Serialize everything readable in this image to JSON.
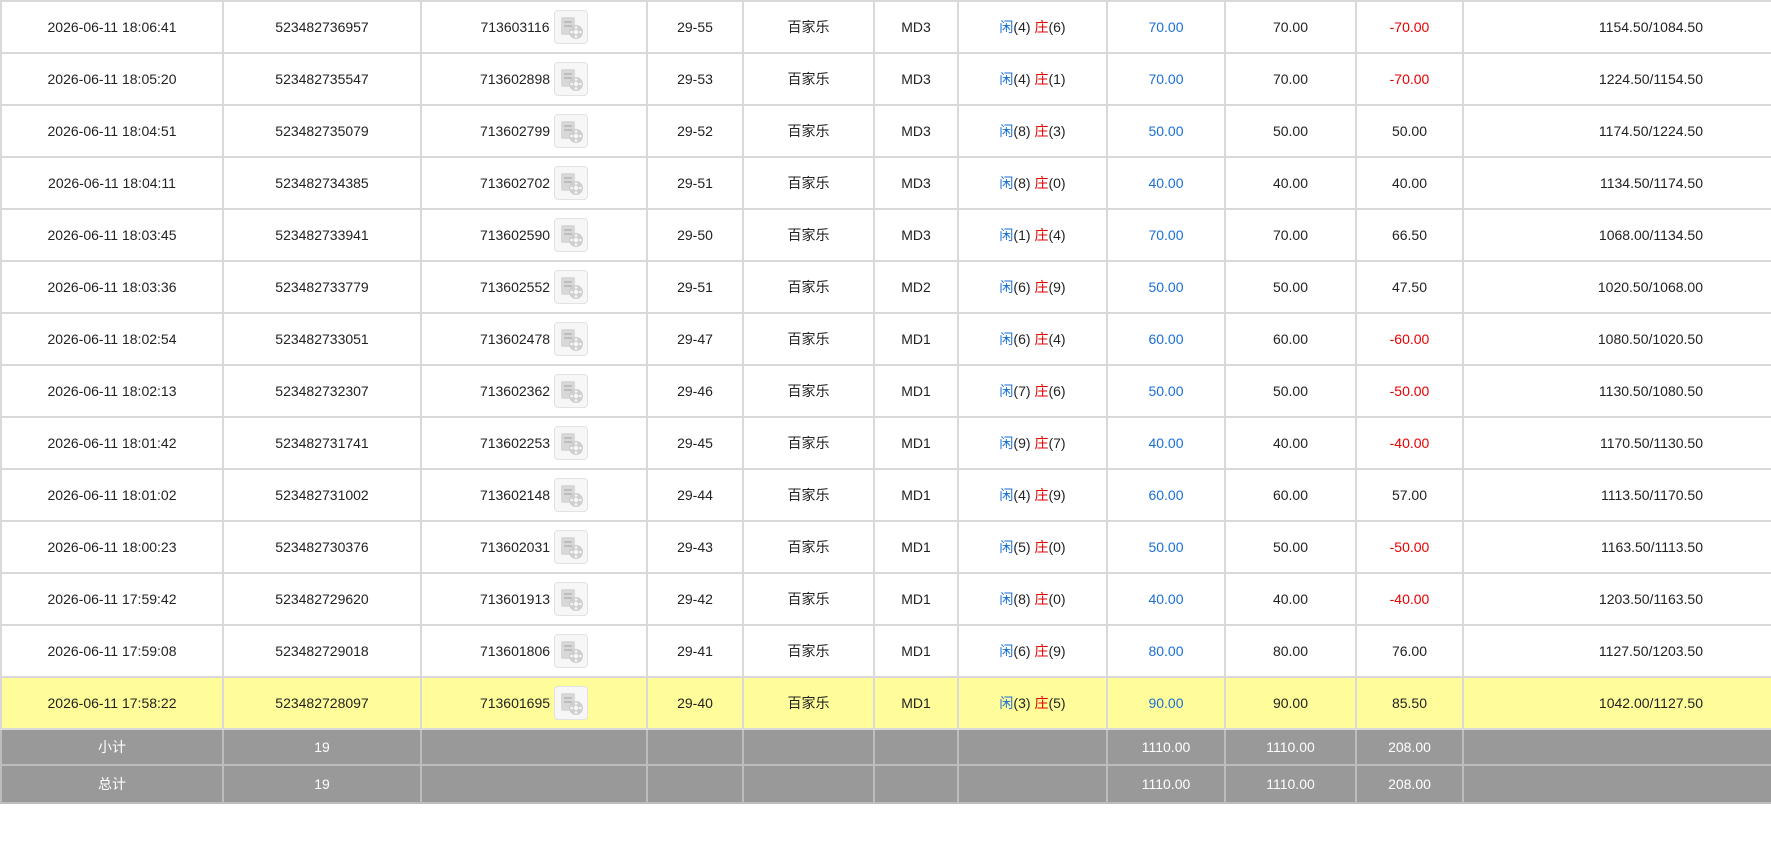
{
  "colors": {
    "player": "#1a6fd6",
    "banker": "#e60000",
    "negative": "#e60000",
    "highlight": "#fffd99",
    "footer": "#999999"
  },
  "icons": {
    "replay": "video-replay-icon"
  },
  "rows": [
    {
      "time": "2026-06-11 18:06:41",
      "bet_id": "523482736957",
      "round_id": "713603116",
      "table": "29-55",
      "game": "百家乐",
      "room": "MD3",
      "r1_label": "闲",
      "r1_val": "(4)",
      "r2_label": "庄",
      "r2_val": "(6)",
      "bet": "70.00",
      "valid": "70.00",
      "win": "-70.00",
      "negative": true,
      "balance": "1154.50/1084.50"
    },
    {
      "time": "2026-06-11 18:05:20",
      "bet_id": "523482735547",
      "round_id": "713602898",
      "table": "29-53",
      "game": "百家乐",
      "room": "MD3",
      "r1_label": "闲",
      "r1_val": "(4)",
      "r2_label": "庄",
      "r2_val": "(1)",
      "bet": "70.00",
      "valid": "70.00",
      "win": "-70.00",
      "negative": true,
      "balance": "1224.50/1154.50"
    },
    {
      "time": "2026-06-11 18:04:51",
      "bet_id": "523482735079",
      "round_id": "713602799",
      "table": "29-52",
      "game": "百家乐",
      "room": "MD3",
      "r1_label": "闲",
      "r1_val": "(8)",
      "r2_label": "庄",
      "r2_val": "(3)",
      "bet": "50.00",
      "valid": "50.00",
      "win": "50.00",
      "negative": false,
      "balance": "1174.50/1224.50"
    },
    {
      "time": "2026-06-11 18:04:11",
      "bet_id": "523482734385",
      "round_id": "713602702",
      "table": "29-51",
      "game": "百家乐",
      "room": "MD3",
      "r1_label": "闲",
      "r1_val": "(8)",
      "r2_label": "庄",
      "r2_val": "(0)",
      "bet": "40.00",
      "valid": "40.00",
      "win": "40.00",
      "negative": false,
      "balance": "1134.50/1174.50"
    },
    {
      "time": "2026-06-11 18:03:45",
      "bet_id": "523482733941",
      "round_id": "713602590",
      "table": "29-50",
      "game": "百家乐",
      "room": "MD3",
      "r1_label": "闲",
      "r1_val": "(1)",
      "r2_label": "庄",
      "r2_val": "(4)",
      "bet": "70.00",
      "valid": "70.00",
      "win": "66.50",
      "negative": false,
      "balance": "1068.00/1134.50"
    },
    {
      "time": "2026-06-11 18:03:36",
      "bet_id": "523482733779",
      "round_id": "713602552",
      "table": "29-51",
      "game": "百家乐",
      "room": "MD2",
      "r1_label": "闲",
      "r1_val": "(6)",
      "r2_label": "庄",
      "r2_val": "(9)",
      "bet": "50.00",
      "valid": "50.00",
      "win": "47.50",
      "negative": false,
      "balance": "1020.50/1068.00"
    },
    {
      "time": "2026-06-11 18:02:54",
      "bet_id": "523482733051",
      "round_id": "713602478",
      "table": "29-47",
      "game": "百家乐",
      "room": "MD1",
      "r1_label": "闲",
      "r1_val": "(6)",
      "r2_label": "庄",
      "r2_val": "(4)",
      "bet": "60.00",
      "valid": "60.00",
      "win": "-60.00",
      "negative": true,
      "balance": "1080.50/1020.50"
    },
    {
      "time": "2026-06-11 18:02:13",
      "bet_id": "523482732307",
      "round_id": "713602362",
      "table": "29-46",
      "game": "百家乐",
      "room": "MD1",
      "r1_label": "闲",
      "r1_val": "(7)",
      "r2_label": "庄",
      "r2_val": "(6)",
      "bet": "50.00",
      "valid": "50.00",
      "win": "-50.00",
      "negative": true,
      "balance": "1130.50/1080.50"
    },
    {
      "time": "2026-06-11 18:01:42",
      "bet_id": "523482731741",
      "round_id": "713602253",
      "table": "29-45",
      "game": "百家乐",
      "room": "MD1",
      "r1_label": "闲",
      "r1_val": "(9)",
      "r2_label": "庄",
      "r2_val": "(7)",
      "bet": "40.00",
      "valid": "40.00",
      "win": "-40.00",
      "negative": true,
      "balance": "1170.50/1130.50"
    },
    {
      "time": "2026-06-11 18:01:02",
      "bet_id": "523482731002",
      "round_id": "713602148",
      "table": "29-44",
      "game": "百家乐",
      "room": "MD1",
      "r1_label": "闲",
      "r1_val": "(4)",
      "r2_label": "庄",
      "r2_val": "(9)",
      "bet": "60.00",
      "valid": "60.00",
      "win": "57.00",
      "negative": false,
      "balance": "1113.50/1170.50"
    },
    {
      "time": "2026-06-11 18:00:23",
      "bet_id": "523482730376",
      "round_id": "713602031",
      "table": "29-43",
      "game": "百家乐",
      "room": "MD1",
      "r1_label": "闲",
      "r1_val": "(5)",
      "r2_label": "庄",
      "r2_val": "(0)",
      "bet": "50.00",
      "valid": "50.00",
      "win": "-50.00",
      "negative": true,
      "balance": "1163.50/1113.50"
    },
    {
      "time": "2026-06-11 17:59:42",
      "bet_id": "523482729620",
      "round_id": "713601913",
      "table": "29-42",
      "game": "百家乐",
      "room": "MD1",
      "r1_label": "闲",
      "r1_val": "(8)",
      "r2_label": "庄",
      "r2_val": "(0)",
      "bet": "40.00",
      "valid": "40.00",
      "win": "-40.00",
      "negative": true,
      "balance": "1203.50/1163.50"
    },
    {
      "time": "2026-06-11 17:59:08",
      "bet_id": "523482729018",
      "round_id": "713601806",
      "table": "29-41",
      "game": "百家乐",
      "room": "MD1",
      "r1_label": "闲",
      "r1_val": "(6)",
      "r2_label": "庄",
      "r2_val": "(9)",
      "bet": "80.00",
      "valid": "80.00",
      "win": "76.00",
      "negative": false,
      "balance": "1127.50/1203.50"
    },
    {
      "time": "2026-06-11 17:58:22",
      "bet_id": "523482728097",
      "round_id": "713601695",
      "table": "29-40",
      "game": "百家乐",
      "room": "MD1",
      "r1_label": "闲",
      "r1_val": "(3)",
      "r2_label": "庄",
      "r2_val": "(5)",
      "bet": "90.00",
      "valid": "90.00",
      "win": "85.50",
      "negative": false,
      "balance": "1042.00/1127.50",
      "highlight": true
    }
  ],
  "subtotal": {
    "label": "小计",
    "count": "19",
    "bet": "1110.00",
    "valid": "1110.00",
    "win": "208.00"
  },
  "total": {
    "label": "总计",
    "count": "19",
    "bet": "1110.00",
    "valid": "1110.00",
    "win": "208.00"
  }
}
